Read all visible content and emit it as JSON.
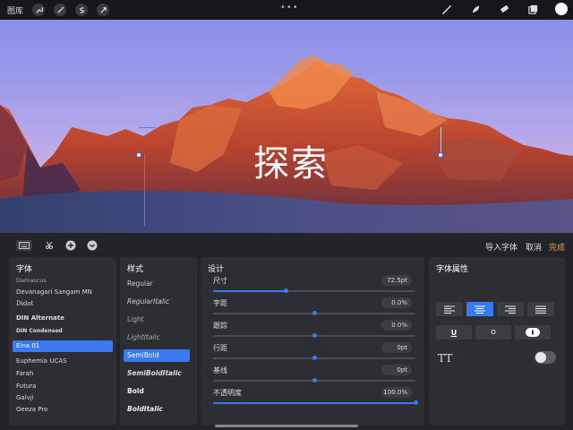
{
  "topbar": {
    "gallery_label": "图库",
    "left_icons": [
      "wrench-icon",
      "magic-wand-icon",
      "selection-s-icon",
      "arrow-cursor-icon"
    ],
    "right_tools": [
      "brush-icon",
      "smudge-icon",
      "eraser-icon",
      "layers-icon"
    ],
    "current_color": "#ffffff"
  },
  "canvas": {
    "text": "探索"
  },
  "panel_toolbar": {
    "import_font": "导入字体",
    "cancel": "取消",
    "done": "完成"
  },
  "fonts": {
    "title": "字体",
    "items": [
      "Damascus",
      "Devanagari Sangam MN",
      "Didot",
      "DIN Alternate",
      "DIN Condensed",
      "Eina 01",
      "Euphemia UCAS",
      "Farah",
      "Futura",
      "Galvji",
      "Geeza Pro"
    ],
    "selected": "Eina 01"
  },
  "styles": {
    "title": "样式",
    "items": [
      "Regular",
      "RegularItalic",
      "Light",
      "LightItalic",
      "SemiBold",
      "SemiBoldItalic",
      "Bold",
      "BoldItalic"
    ],
    "selected": "SemiBold"
  },
  "design": {
    "title": "设计",
    "rows": [
      {
        "label": "尺寸",
        "value": "72.5pt",
        "level": 0.36
      },
      {
        "label": "字距",
        "value": "0.0%",
        "level": 0.5
      },
      {
        "label": "跟踪",
        "value": "0.0%",
        "level": 0.5
      },
      {
        "label": "行距",
        "value": "0pt",
        "level": 0.5
      },
      {
        "label": "基线",
        "value": "0pt",
        "level": 0.5
      },
      {
        "label": "不透明度",
        "value": "100.0%",
        "level": 1.0
      }
    ]
  },
  "attributes": {
    "title": "字体属性",
    "align_options": [
      "align-left-icon",
      "align-center-icon",
      "align-right-icon",
      "align-justify-icon"
    ],
    "selected_align": "align-center-icon",
    "underline_label": "U",
    "outline_label": "O",
    "tt_label": "TT",
    "tt_toggle_on": false
  },
  "colors": {
    "accent": "#3a7af0",
    "done": "#f0a030"
  }
}
